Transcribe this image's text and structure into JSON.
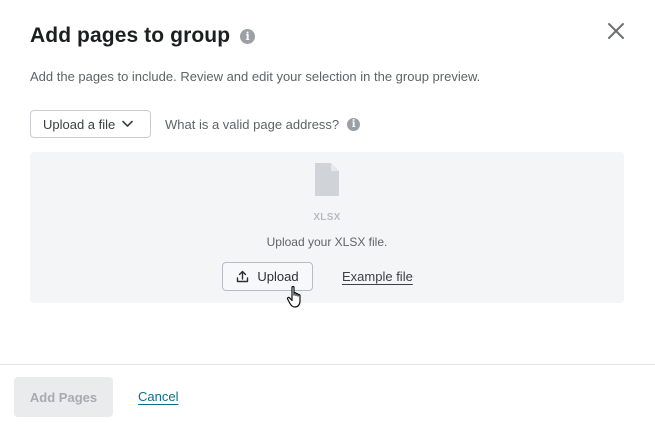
{
  "dialog": {
    "title": "Add pages to group",
    "subtitle": "Add the pages to include. Review and edit your selection in the group preview.",
    "close_label": "×"
  },
  "source_select": {
    "label": "Upload a file"
  },
  "help": {
    "label": "What is a valid page address?"
  },
  "dropzone": {
    "file_type": "XLSX",
    "instruction": "Upload your XLSX file.",
    "upload_label": "Upload",
    "example_label": "Example file"
  },
  "footer": {
    "add_label": "Add Pages",
    "cancel_label": "Cancel"
  },
  "colors": {
    "link": "#0b6e8a",
    "disabled_bg": "#e9ebed",
    "dropzone_bg": "#f4f5f6"
  },
  "icons": [
    "info-icon",
    "close-icon",
    "chevron-down-icon",
    "file-icon",
    "upload-icon",
    "hand-cursor-icon"
  ]
}
